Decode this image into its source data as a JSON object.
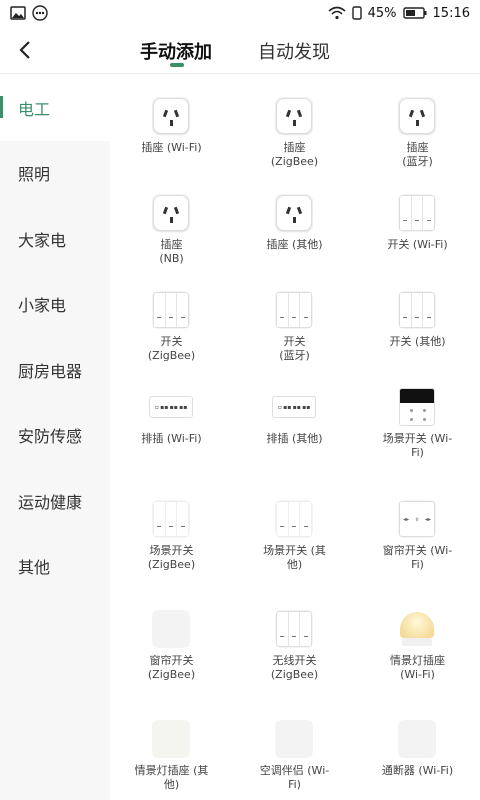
{
  "status_bar": {
    "battery": "45%",
    "time": "15:16"
  },
  "header": {
    "tabs": [
      {
        "label": "手动添加"
      },
      {
        "label": "自动发现"
      }
    ]
  },
  "sidebar": {
    "items": [
      {
        "label": "电工"
      },
      {
        "label": "照明"
      },
      {
        "label": "大家电"
      },
      {
        "label": "小家电"
      },
      {
        "label": "厨房电器"
      },
      {
        "label": "安防传感"
      },
      {
        "label": "运动健康"
      },
      {
        "label": "其他"
      }
    ]
  },
  "devices": [
    {
      "label": "插座 (Wi-Fi)",
      "icon": "socket-icon"
    },
    {
      "label": "插座\n(ZigBee)",
      "icon": "socket-icon"
    },
    {
      "label": "插座\n(蓝牙)",
      "icon": "socket-icon"
    },
    {
      "label": "插座\n(NB)",
      "icon": "socket-icon"
    },
    {
      "label": "插座 (其他)",
      "icon": "socket-icon"
    },
    {
      "label": "开关 (Wi-Fi)",
      "icon": "switch-icon"
    },
    {
      "label": "开关\n(ZigBee)",
      "icon": "switch-icon"
    },
    {
      "label": "开关\n(蓝牙)",
      "icon": "switch-icon"
    },
    {
      "label": "开关 (其他)",
      "icon": "switch-icon"
    },
    {
      "label": "排插 (Wi-Fi)",
      "icon": "power-strip-icon"
    },
    {
      "label": "排插 (其他)",
      "icon": "power-strip-icon"
    },
    {
      "label": "场景开关 (Wi-\nFi)",
      "icon": "scene-switch-icon"
    },
    {
      "label": "场景开关\n(ZigBee)",
      "icon": "plain-switch-icon"
    },
    {
      "label": "场景开关 (其\n他)",
      "icon": "plain-switch-icon"
    },
    {
      "label": "窗帘开关 (Wi-\nFi)",
      "icon": "curtain-switch-icon"
    },
    {
      "label": "窗帘开关\n(ZigBee)",
      "icon": "blank-icon"
    },
    {
      "label": "无线开关\n(ZigBee)",
      "icon": "switch-icon"
    },
    {
      "label": "情景灯插座\n(Wi-Fi)",
      "icon": "lamp-icon"
    },
    {
      "label": "情景灯插座 (其\n他)",
      "icon": "blank-icon"
    },
    {
      "label": "空调伴侣 (Wi-\nFi)",
      "icon": "blank-icon"
    },
    {
      "label": "通断器 (Wi-Fi)",
      "icon": "blank-icon"
    }
  ]
}
